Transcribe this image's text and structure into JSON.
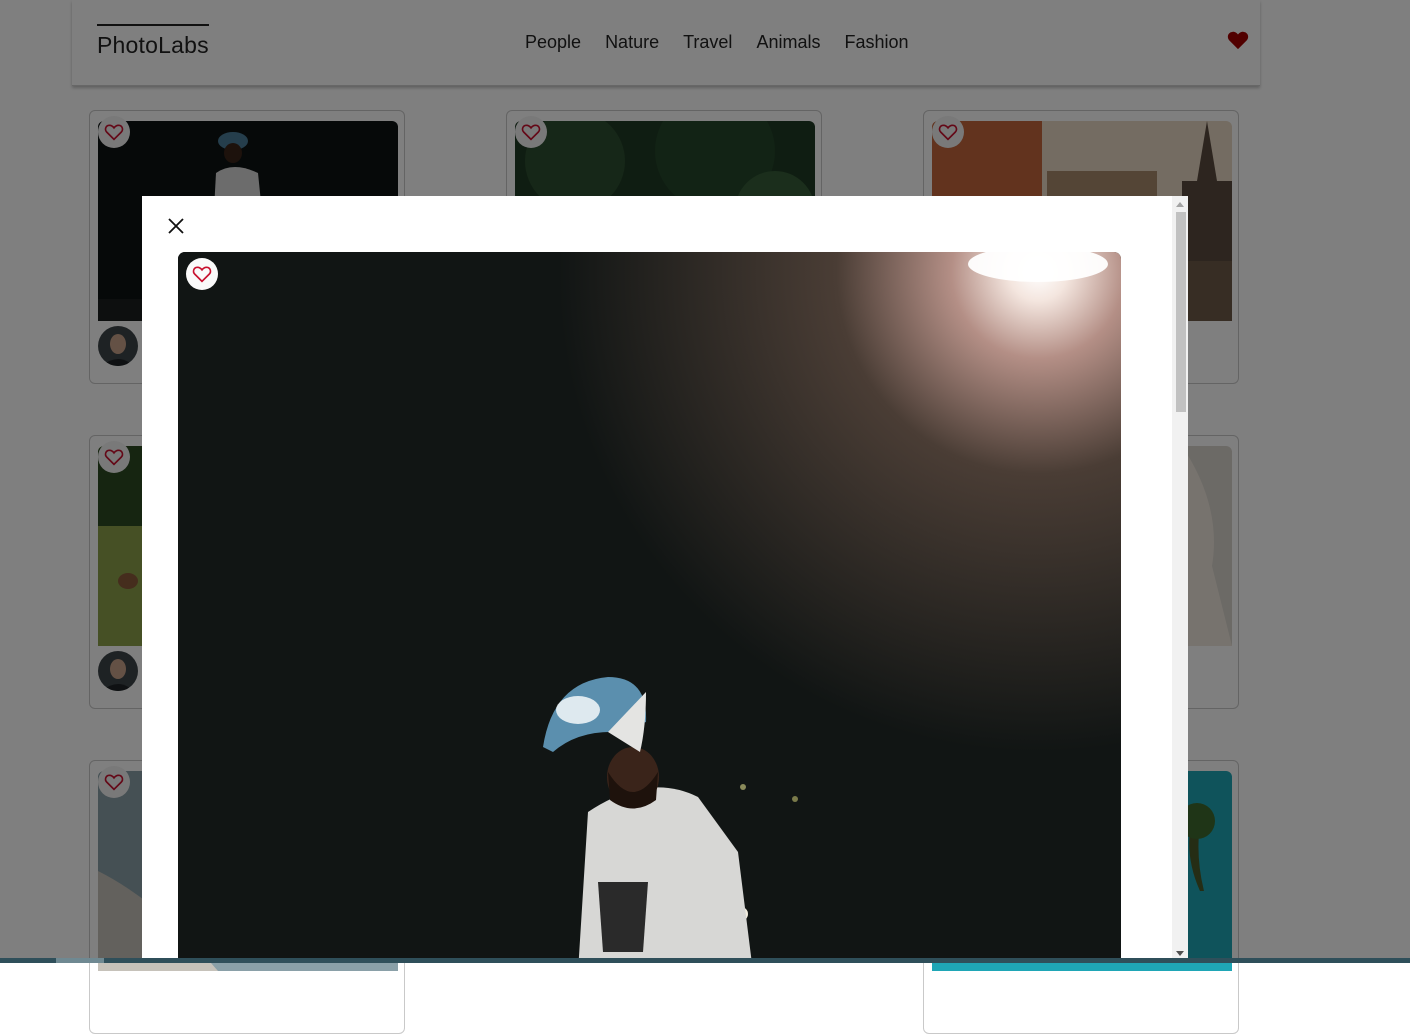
{
  "app": {
    "logo": "PhotoLabs"
  },
  "nav": {
    "topics": [
      "People",
      "Nature",
      "Travel",
      "Animals",
      "Fashion"
    ],
    "favourite_icon": "heart-filled-icon",
    "favourite_color": "#a30000"
  },
  "grid": {
    "cards": [
      {
        "photo": "man-in-cap-at-night",
        "has_avatar": true
      },
      {
        "photo": "forest-trees",
        "has_avatar": false
      },
      {
        "photo": "city-buildings-with-spires",
        "has_avatar": false
      },
      {
        "photo": "horses-on-grass-field",
        "has_avatar": true
      },
      {
        "photo": "person-in-white-dress",
        "has_avatar": false
      },
      {
        "photo": "misty-lake",
        "has_avatar": false
      },
      {
        "photo": "palm-tree-on-teal",
        "has_avatar": false
      }
    ],
    "like_icon": "heart-outline-icon",
    "like_color": "#c8102e"
  },
  "modal": {
    "close_icon": "close-icon",
    "photo": "man-in-blue-trucker-cap-under-street-light",
    "like_icon": "heart-outline-icon"
  },
  "colors": {
    "accent": "#c8102e",
    "overlay": "rgba(0,0,0,0.5)",
    "photo_background": "#111514"
  }
}
